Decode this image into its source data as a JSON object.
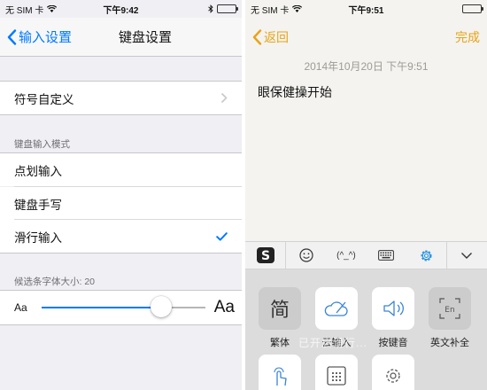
{
  "left": {
    "status": {
      "carrier": "无 SIM 卡",
      "time": "下午9:42"
    },
    "nav": {
      "back_label": "输入设置",
      "title": "键盘设置"
    },
    "custom_symbols": "符号自定义",
    "input_mode": {
      "header": "键盘输入模式",
      "options": [
        "点划输入",
        "键盘手写",
        "滑行输入"
      ],
      "selected": "滑行输入"
    },
    "font_size": {
      "header": "候选条字体大小: 20",
      "small_label": "Aa",
      "large_label": "Aa",
      "slider_fraction": 0.73
    }
  },
  "right": {
    "status": {
      "carrier": "无 SIM 卡",
      "time": "下午9:51"
    },
    "nav": {
      "back_label": "返回",
      "done_label": "完成"
    },
    "note": {
      "date": "2014年10月20日 下午9:51",
      "body": "眼保健操开始"
    },
    "toolbar": {
      "icons": [
        "sogou-logo-icon",
        "emoji-icon",
        "kaomoji-icon",
        "keyboard-icon",
        "settings-icon",
        "chevron-down-icon"
      ],
      "kaomoji": "(^_^)"
    },
    "keys": [
      {
        "label": "繁体",
        "glyph": "简",
        "icon": "traditional-chinese-icon"
      },
      {
        "label": "云输入",
        "icon": "cloud-input-icon"
      },
      {
        "label": "按键音",
        "icon": "key-sound-icon"
      },
      {
        "label": "英文补全",
        "glyph": "En",
        "icon": "english-completion-icon"
      }
    ],
    "watermark": "已开启滑行..."
  },
  "colors": {
    "ios_blue": "#007aff",
    "note_yellow": "#e8a317",
    "battery_green": "#4cd964",
    "settings_blue": "#1e8fe0"
  }
}
